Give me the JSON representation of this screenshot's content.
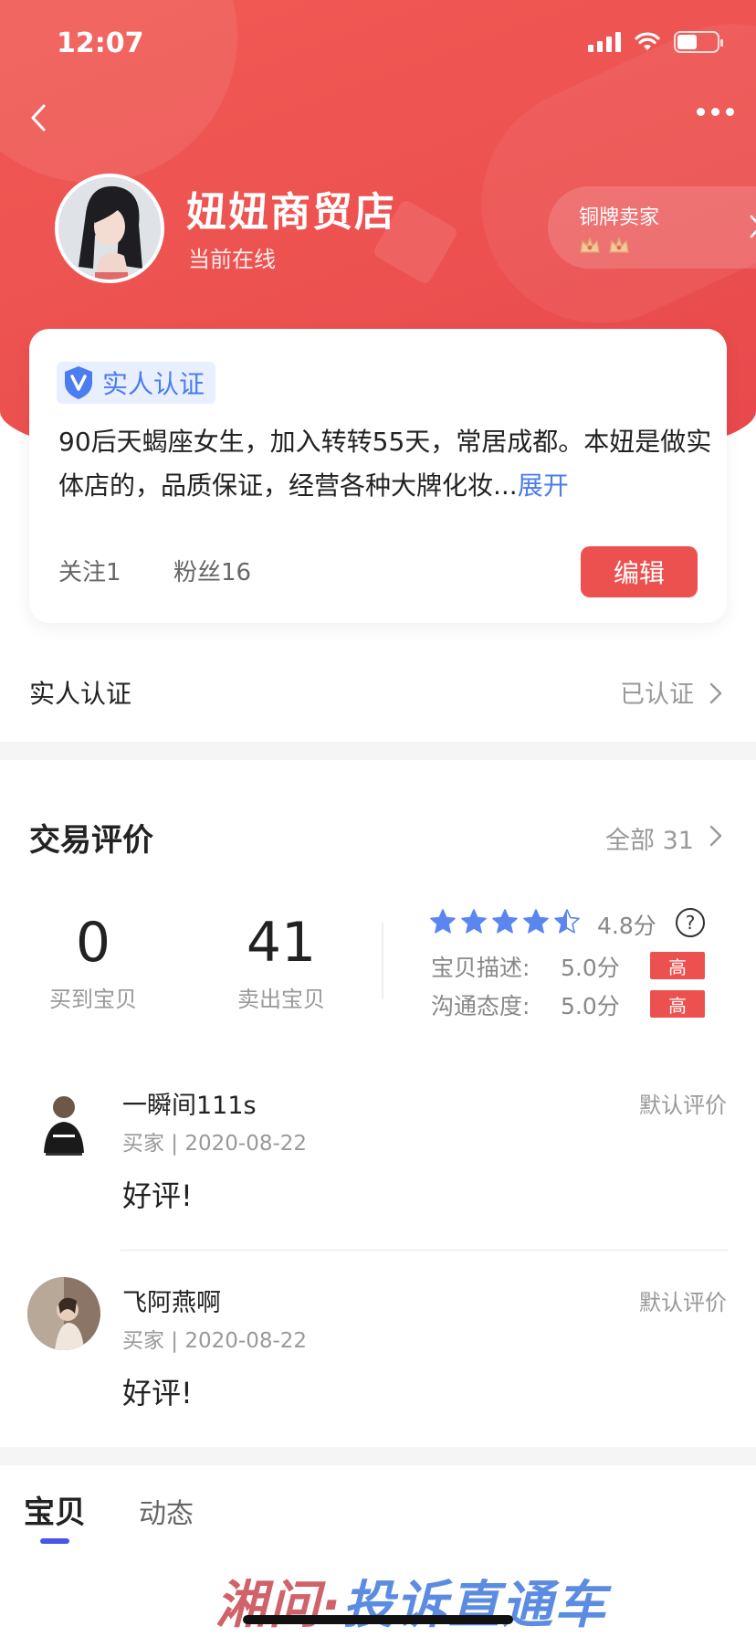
{
  "status_bar": {
    "time": "12:07",
    "battery_level": 0.5
  },
  "colors": {
    "brand_red": "#ec5150",
    "verify_blue": "#4b7cf0",
    "star_blue": "#5b86f0",
    "tab_indicator": "#4b56e6"
  },
  "header": {
    "back_icon": "chevron-left-icon",
    "more_icon": "more-dots-icon",
    "shop_name": "妞妞商贸店",
    "online_status": "当前在线",
    "seller_level": "铜牌卖家",
    "seller_crowns": 2
  },
  "profile": {
    "verify_label": "实人认证",
    "bio": "90后天蝎座女生，加入转转55天，常居成都。本妞是做实体店的，品质保证，经营各种大牌化妆...",
    "expand_label": "展开",
    "following": "关注1",
    "fans": "粉丝16",
    "edit_label": "编辑"
  },
  "verification_row": {
    "label": "实人认证",
    "value": "已认证"
  },
  "reviews": {
    "title": "交易评价",
    "all_label": "全部 31",
    "bought_count": "0",
    "bought_label": "买到宝贝",
    "sold_count": "41",
    "sold_label": "卖出宝贝",
    "rating_stars": 4.5,
    "score_text": "4.8分",
    "help_symbol": "?",
    "metrics": [
      {
        "label": "宝贝描述:",
        "value": "5.0分",
        "badge": "高"
      },
      {
        "label": "沟通态度:",
        "value": "5.0分",
        "badge": "高"
      }
    ],
    "items": [
      {
        "name": "一瞬间111s",
        "meta": "买家 | 2020-08-22",
        "type": "默认评价",
        "content": "好评!"
      },
      {
        "name": "飞阿燕啊",
        "meta": "买家 | 2020-08-22",
        "type": "默认评价",
        "content": "好评!"
      }
    ]
  },
  "tabs": [
    {
      "label": "宝贝",
      "active": true
    },
    {
      "label": "动态",
      "active": false
    }
  ],
  "watermark": {
    "part1": "湘问·",
    "part2": "投诉直通车"
  }
}
